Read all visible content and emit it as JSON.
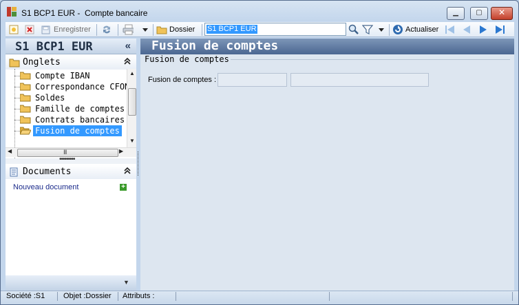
{
  "window": {
    "title": "S1 BCP1 EUR -  Compte bancaire",
    "minimize_glyph": "▁",
    "maximize_glyph": "▢",
    "close_glyph": "✕"
  },
  "toolbar": {
    "save_label": "Enregistrer",
    "folder_label": "Dossier",
    "search_value": "S1 BCP1 EUR",
    "refresh_label": "Actualiser"
  },
  "left_panel": {
    "title": "S1 BCP1 EUR",
    "collapse_glyph": "«",
    "tabs_section": "Onglets",
    "tree_items": [
      {
        "label": "Compte IBAN"
      },
      {
        "label": "Correspondance CFON"
      },
      {
        "label": "Soldes"
      },
      {
        "label": "Famille de comptes"
      },
      {
        "label": "Contrats bancaires"
      },
      {
        "label": "Fusion de comptes",
        "selected": true
      }
    ],
    "documents_section": "Documents",
    "new_document": "Nouveau document",
    "scroll_grip": "III",
    "splitter_grip": "•••••••••"
  },
  "main": {
    "title": "Fusion de comptes",
    "group_title": "Fusion de comptes",
    "field_label": "Fusion de comptes :",
    "field_code": "",
    "field_name": ""
  },
  "status": {
    "company": "Société :S1",
    "object": "Objet :Dossier",
    "attributes": "Attributs :"
  },
  "colors": {
    "accent": "#3399ff",
    "header_gradient_top": "#7d96b8",
    "header_gradient_bottom": "#4b6791"
  }
}
